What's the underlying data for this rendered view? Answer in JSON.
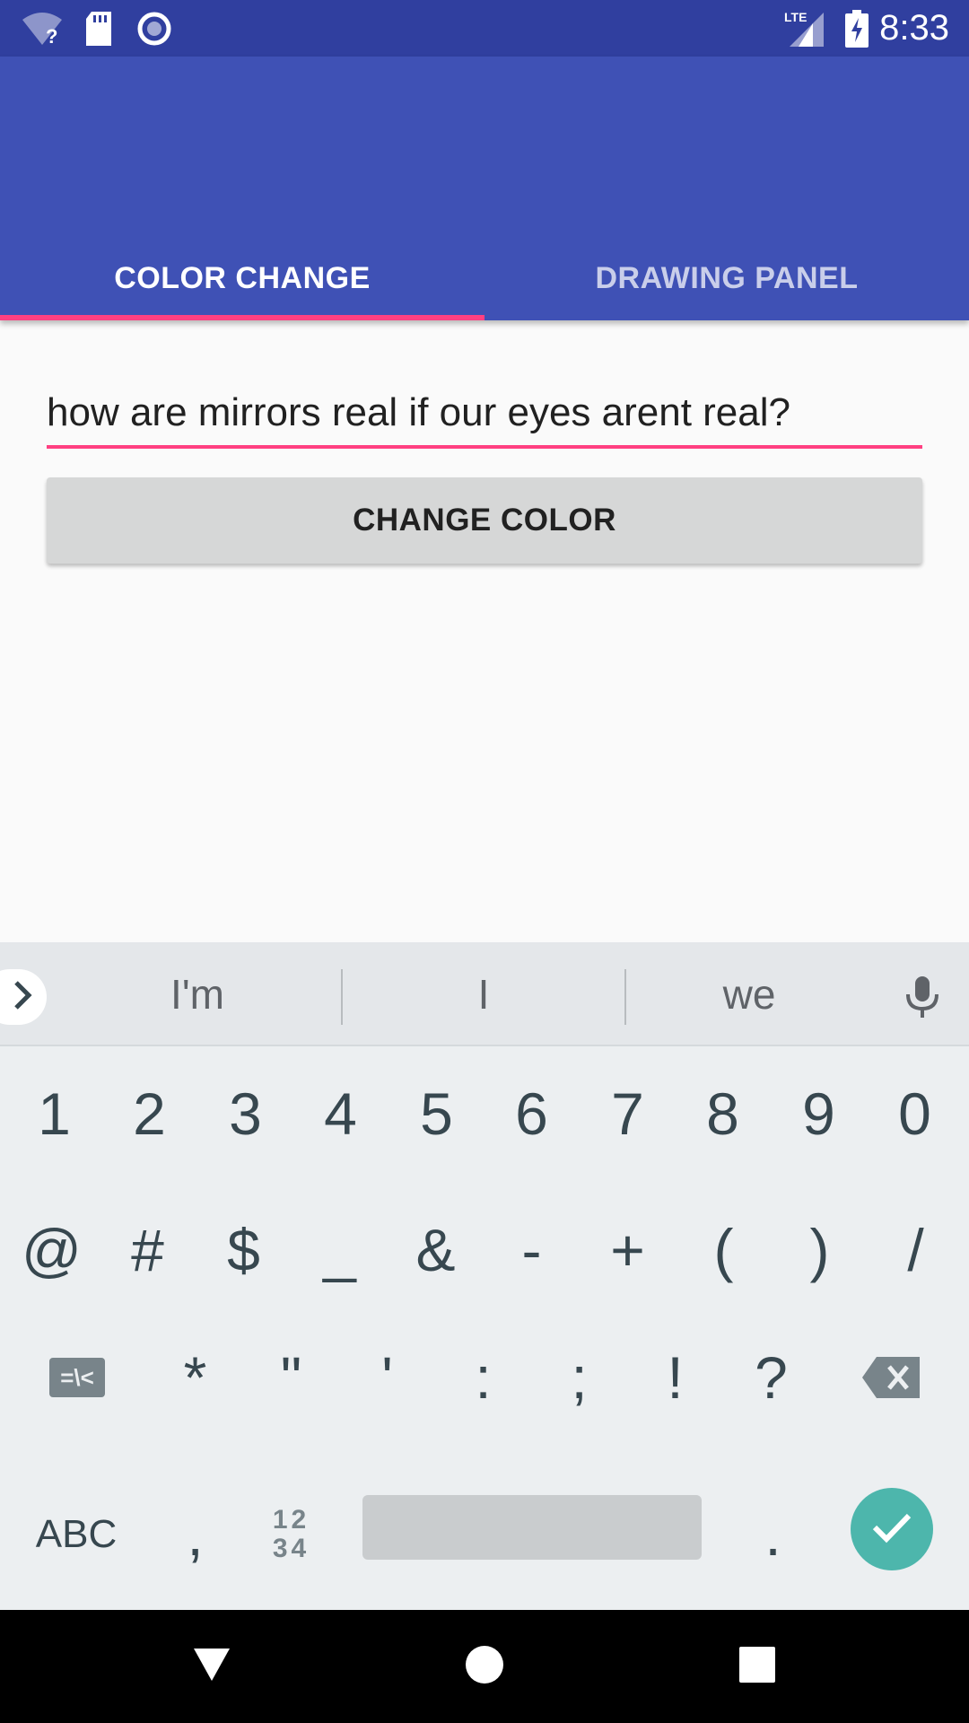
{
  "status_bar": {
    "time": "8:33",
    "network_label": "LTE",
    "icons": [
      "wifi-question-icon",
      "sd-card-icon",
      "sync-circle-icon",
      "signal-icon",
      "battery-charging-icon"
    ]
  },
  "tabs": [
    {
      "label": "COLOR CHANGE",
      "selected": true
    },
    {
      "label": "DRAWING PANEL",
      "selected": false
    }
  ],
  "input": {
    "value": "how are mirrors real if our eyes arent real?"
  },
  "button": {
    "label": "CHANGE COLOR"
  },
  "keyboard": {
    "suggestions": [
      "I'm",
      "I",
      "we"
    ],
    "row1": [
      "1",
      "2",
      "3",
      "4",
      "5",
      "6",
      "7",
      "8",
      "9",
      "0"
    ],
    "row2": [
      "@",
      "#",
      "$",
      "_",
      "&",
      "-",
      "+",
      "(",
      ")",
      "/"
    ],
    "row3": [
      "*",
      "\"",
      "'",
      ":",
      ";",
      "!",
      "?"
    ],
    "symbols_toggle": "=\\<",
    "abc_label": "ABC",
    "comma": ",",
    "numpad_top": "12",
    "numpad_bottom": "34",
    "period": "."
  },
  "colors": {
    "primary": "#3f51b5",
    "primary_dark": "#303f9f",
    "accent": "#ff4081",
    "keyboard_bg": "#eceff1",
    "enter_key": "#4db6ac"
  }
}
